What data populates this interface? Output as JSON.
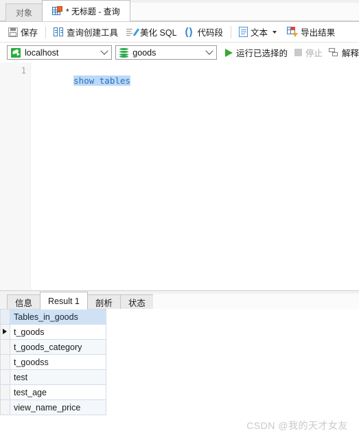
{
  "window_tabs": {
    "object_tab": "对象",
    "query_tab": "* 无标题 - 查询"
  },
  "toolbar": {
    "save": "保存",
    "query_builder": "查询创建工具",
    "beautify_sql": "美化 SQL",
    "code_snippet": "代码段",
    "text": "文本",
    "export_result": "导出结果"
  },
  "connection_bar": {
    "host": "localhost",
    "database": "goods",
    "run_selected": "运行已选择的",
    "stop": "停止",
    "explain": "解释"
  },
  "editor": {
    "line_number": "1",
    "sql_text": "show tables"
  },
  "result_tabs": {
    "info": "信息",
    "result1": "Result 1",
    "profile": "剖析",
    "status": "状态"
  },
  "result_grid": {
    "column_header": "Tables_in_goods",
    "rows": [
      "t_goods",
      "t_goods_category",
      "t_goodss",
      "test",
      "test_age",
      "view_name_price"
    ]
  },
  "watermark": "CSDN @我的天才女友",
  "colors": {
    "accent_green": "#38a832",
    "header_blue": "#cfe2f5",
    "selection_blue": "#bcd9f7",
    "sql_text_blue": "#2a6ec0",
    "export_orange": "#e8642a"
  }
}
